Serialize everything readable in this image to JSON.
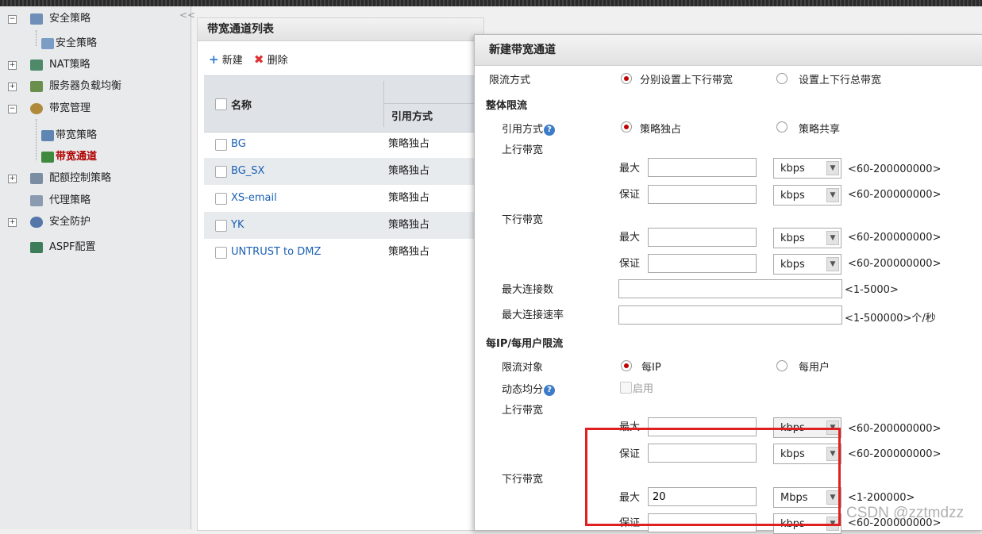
{
  "sidebar": {
    "items": [
      {
        "label": "安全策略",
        "toggle": "−"
      },
      {
        "label": "安全策略"
      },
      {
        "label": "NAT策略",
        "toggle": "+"
      },
      {
        "label": "服务器负载均衡",
        "toggle": "+"
      },
      {
        "label": "带宽管理",
        "toggle": "−"
      },
      {
        "label": "带宽策略"
      },
      {
        "label": "带宽通道"
      },
      {
        "label": "配额控制策略",
        "toggle": "+"
      },
      {
        "label": "代理策略"
      },
      {
        "label": "安全防护",
        "toggle": "+"
      },
      {
        "label": "ASPF配置"
      }
    ],
    "collapse_glyph": "<<"
  },
  "list_panel": {
    "title": "带宽通道列表",
    "toolbar": {
      "new_label": "新建",
      "delete_label": "删除"
    },
    "columns": {
      "name": "名称",
      "ref": "引用方式"
    },
    "rows": [
      {
        "name": "BG",
        "ref": "策略独占"
      },
      {
        "name": "BG_SX",
        "ref": "策略独占"
      },
      {
        "name": "XS-email",
        "ref": "策略独占"
      },
      {
        "name": "YK",
        "ref": "策略独占"
      },
      {
        "name": "UNTRUST to DMZ",
        "ref": "策略独占"
      }
    ]
  },
  "dialog": {
    "title": "新建带宽通道",
    "limit_mode": {
      "label": "限流方式",
      "option_separate": "分别设置上下行带宽",
      "option_total": "设置上下行总带宽"
    },
    "overall": {
      "section": "整体限流",
      "ref_label": "引用方式",
      "ref_option_exclusive": "策略独占",
      "ref_option_shared": "策略共享",
      "up_label": "上行带宽",
      "down_label": "下行带宽",
      "max_label": "最大",
      "guarantee_label": "保证",
      "unit": "kbps",
      "range_hint": "<60-200000000>",
      "max_conn_label": "最大连接数",
      "max_conn_hint": "<1-5000>",
      "max_rate_label": "最大连接速率",
      "max_rate_hint": "<1-500000>个/秒"
    },
    "per_ip": {
      "section": "每IP/每用户限流",
      "target_label": "限流对象",
      "option_ip": "每IP",
      "option_user": "每用户",
      "dynamic_label": "动态均分",
      "enable_label": "启用",
      "up_label": "上行带宽",
      "down_label": "下行带宽",
      "max_label": "最大",
      "guarantee_label": "保证",
      "unit": "kbps",
      "range_hint": "<60-200000000>",
      "down_max_value": "20",
      "down_max_unit": "Mbps",
      "down_max_hint": "<1-200000>"
    }
  },
  "watermark": "CSDN @zztmdzz",
  "colors": {
    "accent_red": "#e02020",
    "link_blue": "#1a5fb4",
    "selected": "#b00000"
  }
}
